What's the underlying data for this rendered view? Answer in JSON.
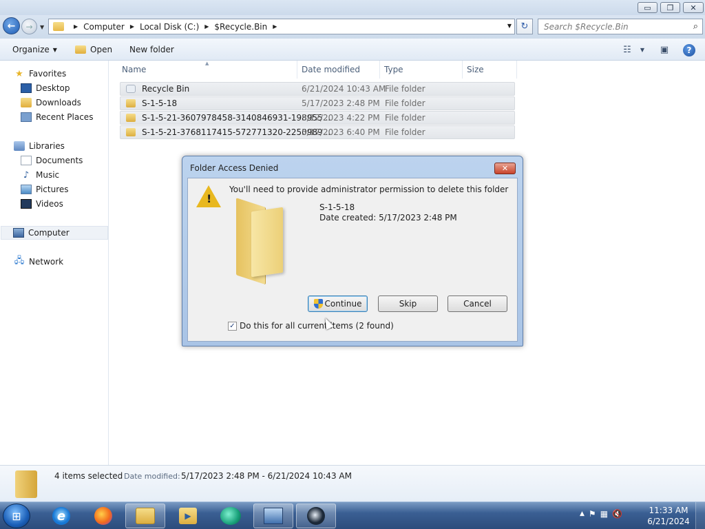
{
  "window": {
    "buttons": {
      "minimize": "▭",
      "maximize": "❐",
      "close": "✕"
    }
  },
  "address": {
    "segments": [
      "Computer",
      "Local Disk (C:)",
      "$Recycle.Bin"
    ],
    "search_placeholder": "Search $Recycle.Bin"
  },
  "toolbar": {
    "organize": "Organize",
    "open": "Open",
    "new_folder": "New folder"
  },
  "nav": {
    "favorites": "Favorites",
    "desktop": "Desktop",
    "downloads": "Downloads",
    "recent_places": "Recent Places",
    "libraries": "Libraries",
    "documents": "Documents",
    "music": "Music",
    "pictures": "Pictures",
    "videos": "Videos",
    "computer": "Computer",
    "network": "Network"
  },
  "columns": {
    "name": "Name",
    "date_modified": "Date modified",
    "type": "Type",
    "size": "Size"
  },
  "files": [
    {
      "name": "Recycle Bin",
      "date": "6/21/2024 10:43 AM",
      "type": "File folder",
      "icon": "recycle-bin-icon"
    },
    {
      "name": "S-1-5-18",
      "date": "5/17/2023 2:48 PM",
      "type": "File folder",
      "icon": "folder-icon"
    },
    {
      "name": "S-1-5-21-3607978458-3140846931-198955...",
      "date": "5/17/2023 4:22 PM",
      "type": "File folder",
      "icon": "folder-icon"
    },
    {
      "name": "S-1-5-21-3768117415-572771320-2250989...",
      "date": "5/17/2023 6:40 PM",
      "type": "File folder",
      "icon": "folder-icon"
    }
  ],
  "details": {
    "count": "4 items selected",
    "label": "Date modified:",
    "value": "5/17/2023 2:48 PM - 6/21/2024 10:43 AM"
  },
  "dialog": {
    "title": "Folder Access Denied",
    "message": "You'll need to provide administrator permission to delete this folder",
    "folder_name": "S-1-5-18",
    "date_created": "Date created: 5/17/2023 2:48 PM",
    "continue": "Continue",
    "skip": "Skip",
    "cancel": "Cancel",
    "checkbox_label": "Do this for all current items (2 found)",
    "checkbox_checked": true
  },
  "clock": {
    "time": "11:33 AM",
    "date": "6/21/2024"
  }
}
